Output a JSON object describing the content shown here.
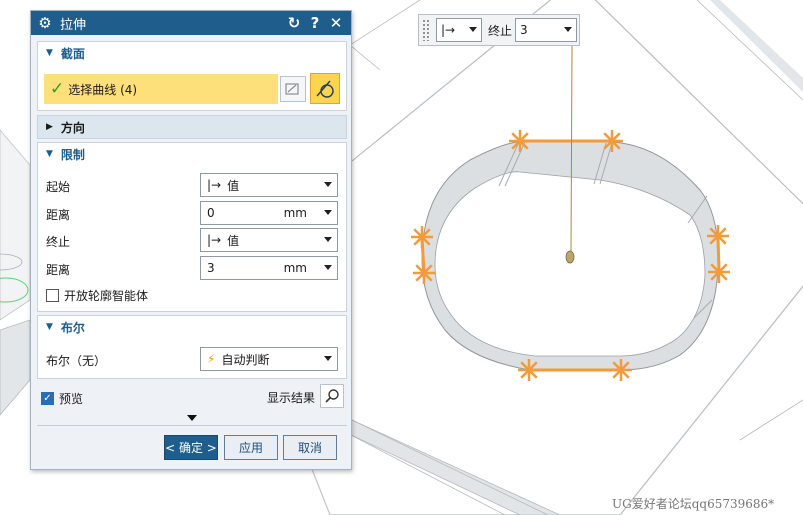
{
  "dialog": {
    "title": "拉伸",
    "sections": {
      "section": {
        "title": "截面",
        "select_curve_label": "选择曲线 (4)"
      },
      "direction": {
        "title": "方向"
      },
      "limits": {
        "title": "限制",
        "start_label": "起始",
        "start_value": "值",
        "start_distance_label": "距离",
        "start_distance_value": "0",
        "start_distance_unit": "mm",
        "end_label": "终止",
        "end_value": "值",
        "end_distance_label": "距离",
        "end_distance_value": "3",
        "end_distance_unit": "mm",
        "open_profile_label": "开放轮廓智能体"
      },
      "boolean": {
        "title": "布尔",
        "label": "布尔（无）",
        "value": "自动判断"
      }
    },
    "preview_label": "预览",
    "show_result_label": "显示结果",
    "buttons": {
      "ok": "< 确定 >",
      "apply": "应用",
      "cancel": "取消"
    },
    "open_profile_checked": false,
    "preview_checked": true
  },
  "floating_toolbar": {
    "end_label": "终止",
    "end_value": "3"
  },
  "watermark": "UG爱好者论坛qq65739686*",
  "colors": {
    "title_bar": "#1f5e8c",
    "selection_highlight": "#fde079",
    "handle_orange": "#f39a3b",
    "model_wall": "#dcdfe1"
  },
  "icons": [
    "gear-icon",
    "reset-icon",
    "help-icon",
    "close-icon",
    "check-icon",
    "curve-select-icon",
    "sketch-section-icon",
    "limit-value-icon",
    "lightning-icon",
    "magnifier-icon",
    "expand-triangle-icon"
  ]
}
